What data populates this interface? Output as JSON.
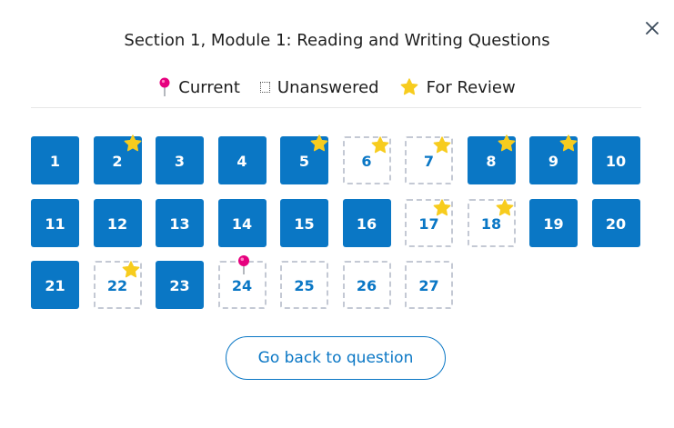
{
  "dialog": {
    "title": "Section 1, Module 1: Reading and Writing Questions",
    "close_icon": "close-icon"
  },
  "legend": {
    "current_label": "Current",
    "unanswered_label": "Unanswered",
    "review_label": "For Review"
  },
  "colors": {
    "answered": "#0a77c5",
    "pin": "#e6007e",
    "star": "#f7cc1e"
  },
  "questions": [
    {
      "label": "1",
      "answered": true,
      "review": false,
      "current": false
    },
    {
      "label": "2",
      "answered": true,
      "review": true,
      "current": false
    },
    {
      "label": "3",
      "answered": true,
      "review": false,
      "current": false
    },
    {
      "label": "4",
      "answered": true,
      "review": false,
      "current": false
    },
    {
      "label": "5",
      "answered": true,
      "review": true,
      "current": false
    },
    {
      "label": "6",
      "answered": false,
      "review": true,
      "current": false
    },
    {
      "label": "7",
      "answered": false,
      "review": true,
      "current": false
    },
    {
      "label": "8",
      "answered": true,
      "review": true,
      "current": false
    },
    {
      "label": "9",
      "answered": true,
      "review": true,
      "current": false
    },
    {
      "label": "10",
      "answered": true,
      "review": false,
      "current": false
    },
    {
      "label": "11",
      "answered": true,
      "review": false,
      "current": false
    },
    {
      "label": "12",
      "answered": true,
      "review": false,
      "current": false
    },
    {
      "label": "13",
      "answered": true,
      "review": false,
      "current": false
    },
    {
      "label": "14",
      "answered": true,
      "review": false,
      "current": false
    },
    {
      "label": "15",
      "answered": true,
      "review": false,
      "current": false
    },
    {
      "label": "16",
      "answered": true,
      "review": false,
      "current": false
    },
    {
      "label": "17",
      "answered": false,
      "review": true,
      "current": false
    },
    {
      "label": "18",
      "answered": false,
      "review": true,
      "current": false
    },
    {
      "label": "19",
      "answered": true,
      "review": false,
      "current": false
    },
    {
      "label": "20",
      "answered": true,
      "review": false,
      "current": false
    },
    {
      "label": "21",
      "answered": true,
      "review": false,
      "current": false
    },
    {
      "label": "22",
      "answered": false,
      "review": true,
      "current": false
    },
    {
      "label": "23",
      "answered": true,
      "review": false,
      "current": false
    },
    {
      "label": "24",
      "answered": false,
      "review": false,
      "current": true
    },
    {
      "label": "25",
      "answered": false,
      "review": false,
      "current": false
    },
    {
      "label": "26",
      "answered": false,
      "review": false,
      "current": false
    },
    {
      "label": "27",
      "answered": false,
      "review": false,
      "current": false
    }
  ],
  "footer": {
    "go_back_label": "Go back to question"
  }
}
